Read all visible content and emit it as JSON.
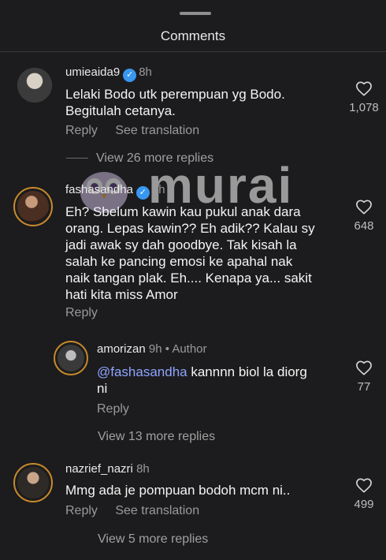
{
  "header": {
    "title": "Comments"
  },
  "watermark": {
    "text": "murai"
  },
  "comments": [
    {
      "username": "umieaida9",
      "verified": true,
      "time": "8h",
      "text_lines": [
        "Lelaki Bodo utk perempuan yg Bodo.",
        "Begitulah cetanya."
      ],
      "reply_label": "Reply",
      "see_translation": "See translation",
      "likes": "1,078",
      "more_replies": "View 26 more replies"
    },
    {
      "username": "fashasandha",
      "verified": true,
      "time": "9h",
      "text_lines": [
        "Eh? Sbelum kawin kau pukul anak dara",
        "orang. Lepas kawin?? Eh adik?? Kalau sy",
        "jadi awak sy dah goodbye. Tak kisah la",
        "salah ke pancing emosi ke apahal nak",
        "naik tangan plak. Eh.... Kenapa ya... sakit",
        "hati kita miss Amor"
      ],
      "reply_label": "Reply",
      "likes": "648"
    },
    {
      "username": "amorizan",
      "time": "9h",
      "author_label": "• Author",
      "mention": "@fashasandha",
      "text_after_mention": " kannnn biol la diorg",
      "text_line2": "ni",
      "reply_label": "Reply",
      "likes": "77",
      "more_replies": "View 13 more replies"
    },
    {
      "username": "nazrief_nazri",
      "time": "8h",
      "text_lines": [
        "Mmg ada je pompuan bodoh mcm ni.."
      ],
      "reply_label": "Reply",
      "see_translation": "See translation",
      "likes": "499",
      "more_replies": "View 5 more replies"
    }
  ],
  "colors": {
    "background": "#1c1c1e",
    "mention": "#8ea4ff",
    "verified": "#3897f0",
    "ring": "#c98a2a"
  },
  "icons": {
    "like": "heart-outline-icon",
    "verified": "verified-badge-icon"
  }
}
